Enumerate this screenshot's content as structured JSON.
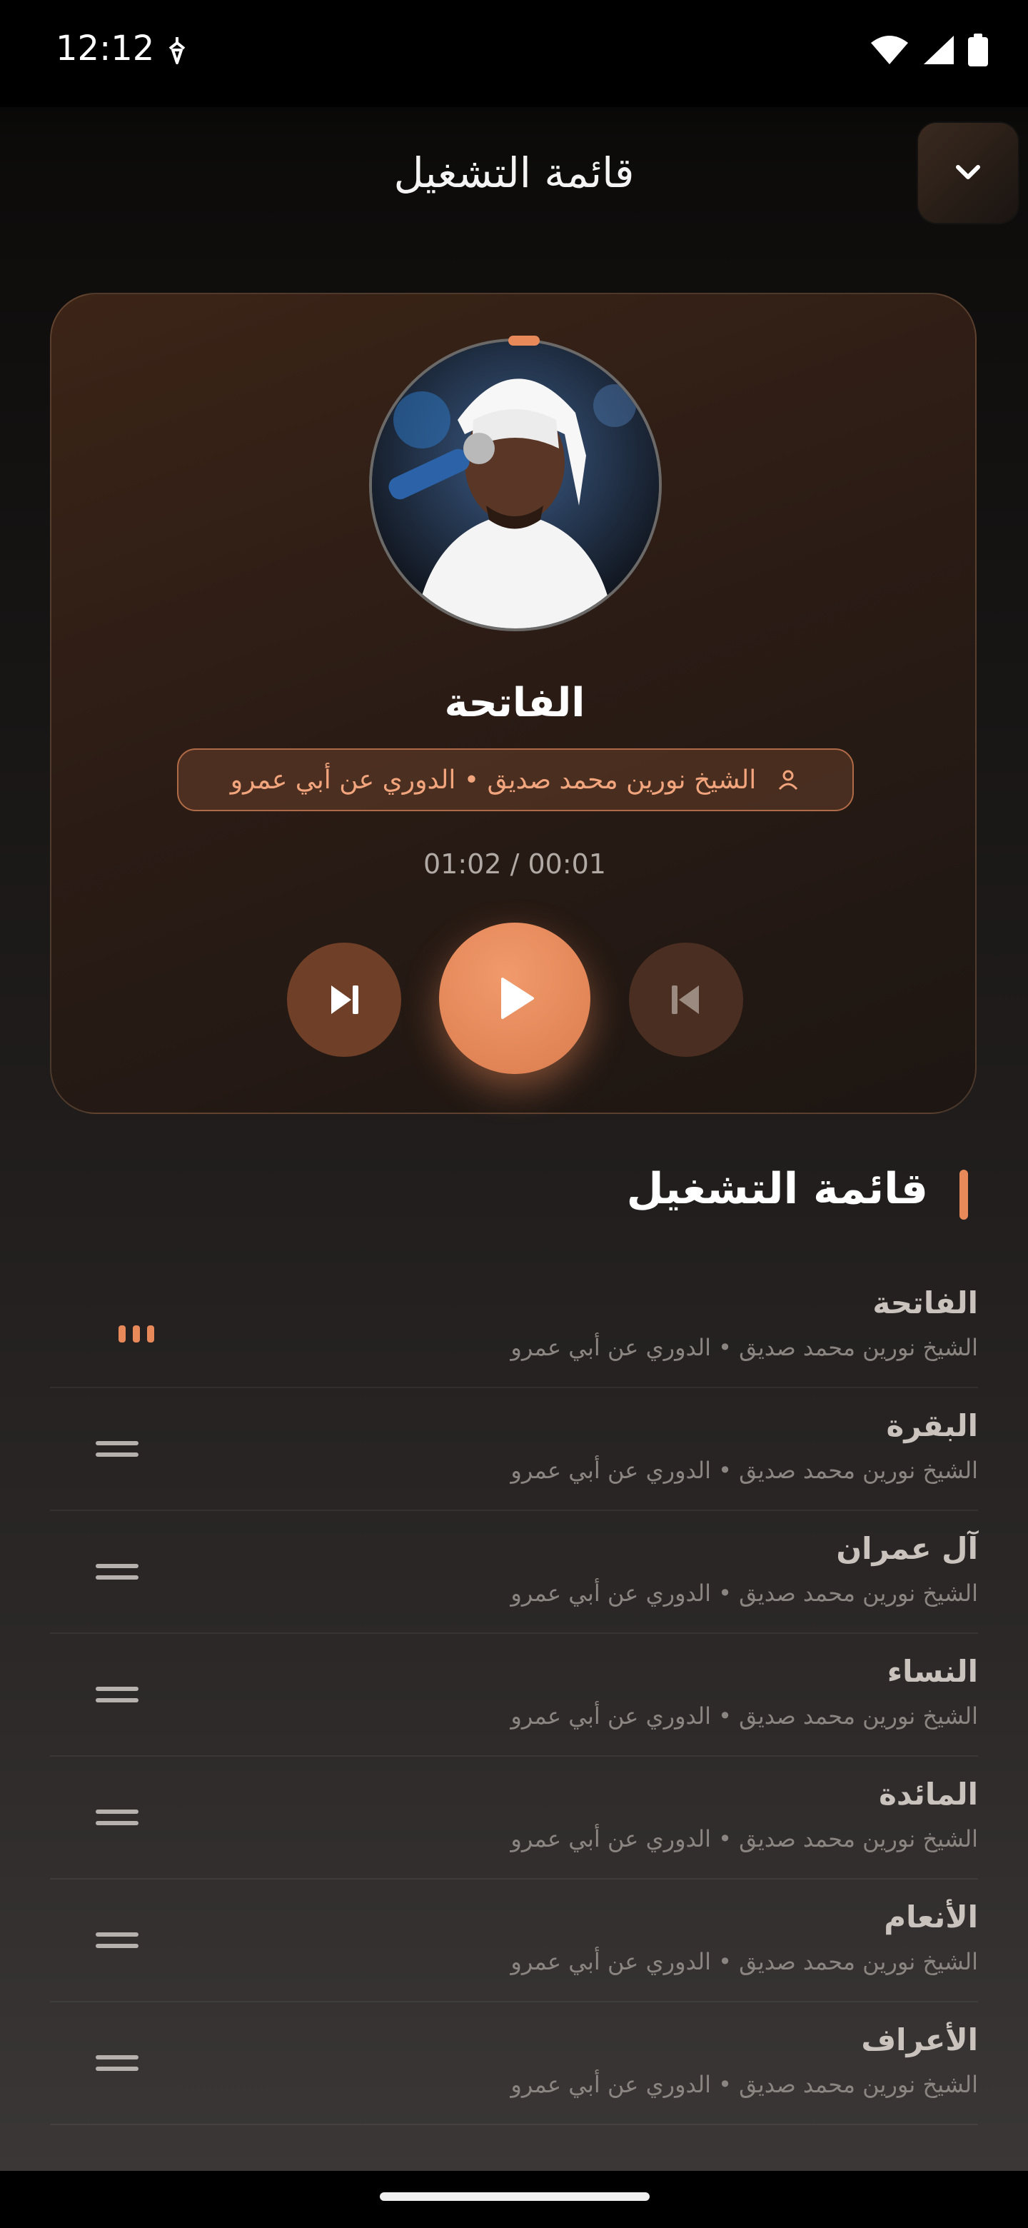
{
  "status_bar": {
    "time": "12:12",
    "icons": [
      "notification-icon",
      "wifi-icon",
      "signal-icon",
      "battery-icon"
    ]
  },
  "header": {
    "title": "قائمة التشغيل",
    "collapse_icon": "chevron-down-icon"
  },
  "player": {
    "track_title": "الفاتحة",
    "reciter_line": "الشيخ نورين محمد صديق • الدوري عن أبي عمرو",
    "time": "01:02 / 00:01",
    "controls": [
      "skip-next-icon",
      "play-icon",
      "skip-previous-icon"
    ]
  },
  "playlist": {
    "title": "قائمة التشغيل",
    "items": [
      {
        "title": "الفاتحة",
        "subtitle": "الشيخ نورين محمد صديق • الدوري عن أبي عمرو",
        "playing": true
      },
      {
        "title": "البقرة",
        "subtitle": "الشيخ نورين محمد صديق • الدوري عن أبي عمرو"
      },
      {
        "title": "آل عمران",
        "subtitle": "الشيخ نورين محمد صديق • الدوري عن أبي عمرو"
      },
      {
        "title": "النساء",
        "subtitle": "الشيخ نورين محمد صديق • الدوري عن أبي عمرو"
      },
      {
        "title": "المائدة",
        "subtitle": "الشيخ نورين محمد صديق • الدوري عن أبي عمرو"
      },
      {
        "title": "الأنعام",
        "subtitle": "الشيخ نورين محمد صديق • الدوري عن أبي عمرو"
      },
      {
        "title": "الأعراف",
        "subtitle": "الشيخ نورين محمد صديق • الدوري عن أبي عمرو"
      }
    ]
  },
  "colors": {
    "accent": "#e8895a",
    "background": "#171514"
  }
}
